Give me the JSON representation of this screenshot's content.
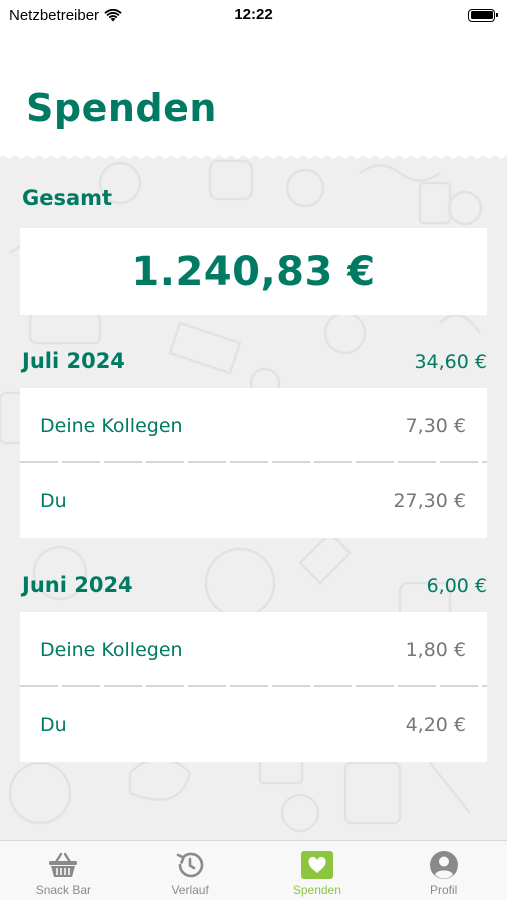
{
  "status_bar": {
    "carrier": "Netzbetreiber",
    "time": "12:22"
  },
  "page": {
    "title": "Spenden"
  },
  "total": {
    "label": "Gesamt",
    "value": "1.240,83 €"
  },
  "months": [
    {
      "label": "Juli 2024",
      "amount": "34,60 €",
      "rows": [
        {
          "label": "Deine Kollegen",
          "value": "7,30 €"
        },
        {
          "label": "Du",
          "value": "27,30 €"
        }
      ]
    },
    {
      "label": "Juni 2024",
      "amount": "6,00 €",
      "rows": [
        {
          "label": "Deine Kollegen",
          "value": "1,80 €"
        },
        {
          "label": "Du",
          "value": "4,20 €"
        }
      ]
    }
  ],
  "tab_bar": {
    "tabs": [
      {
        "label": "Snack Bar",
        "icon": "basket-icon",
        "active": false
      },
      {
        "label": "Verlauf",
        "icon": "history-icon",
        "active": false
      },
      {
        "label": "Spenden",
        "icon": "heart-icon",
        "active": true
      },
      {
        "label": "Profil",
        "icon": "profile-icon",
        "active": false
      }
    ]
  },
  "colors": {
    "primary": "#007a63",
    "active_tab": "#8cc63f",
    "inactive_tab": "#8a8a8a",
    "background_pattern": "#efefef"
  }
}
